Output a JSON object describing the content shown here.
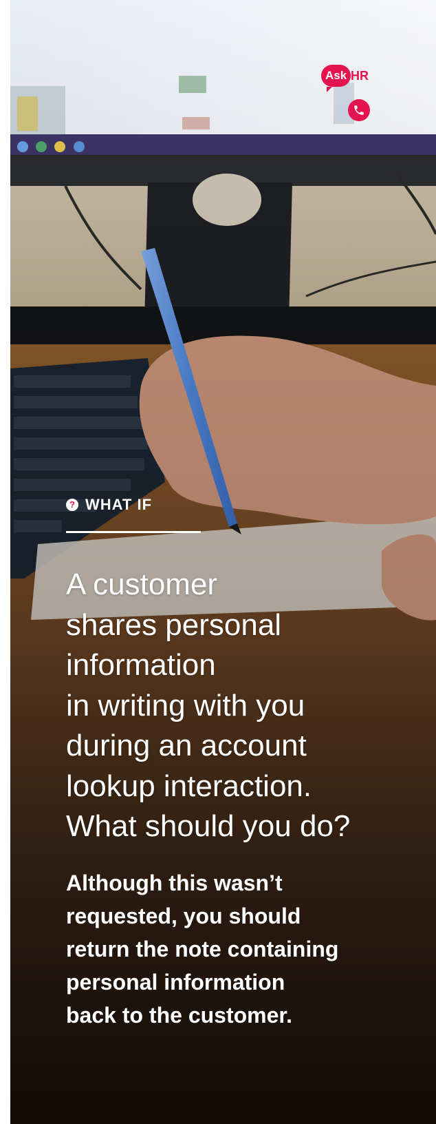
{
  "brand": {
    "ask": "Ask",
    "hr": "HR",
    "accent_color": "#e4134f"
  },
  "call_button": {
    "icon": "phone-icon"
  },
  "section": {
    "icon": "question-icon",
    "icon_glyph": "?",
    "label": "WHAT IF"
  },
  "question": "A customer\nshares personal\ninformation\nin writing with you\nduring an account\nlookup interaction.\nWhat should you do?",
  "answer": "Although this wasn’t\nrequested, you should\nreturn the note containing\npersonal information\nback to the customer."
}
